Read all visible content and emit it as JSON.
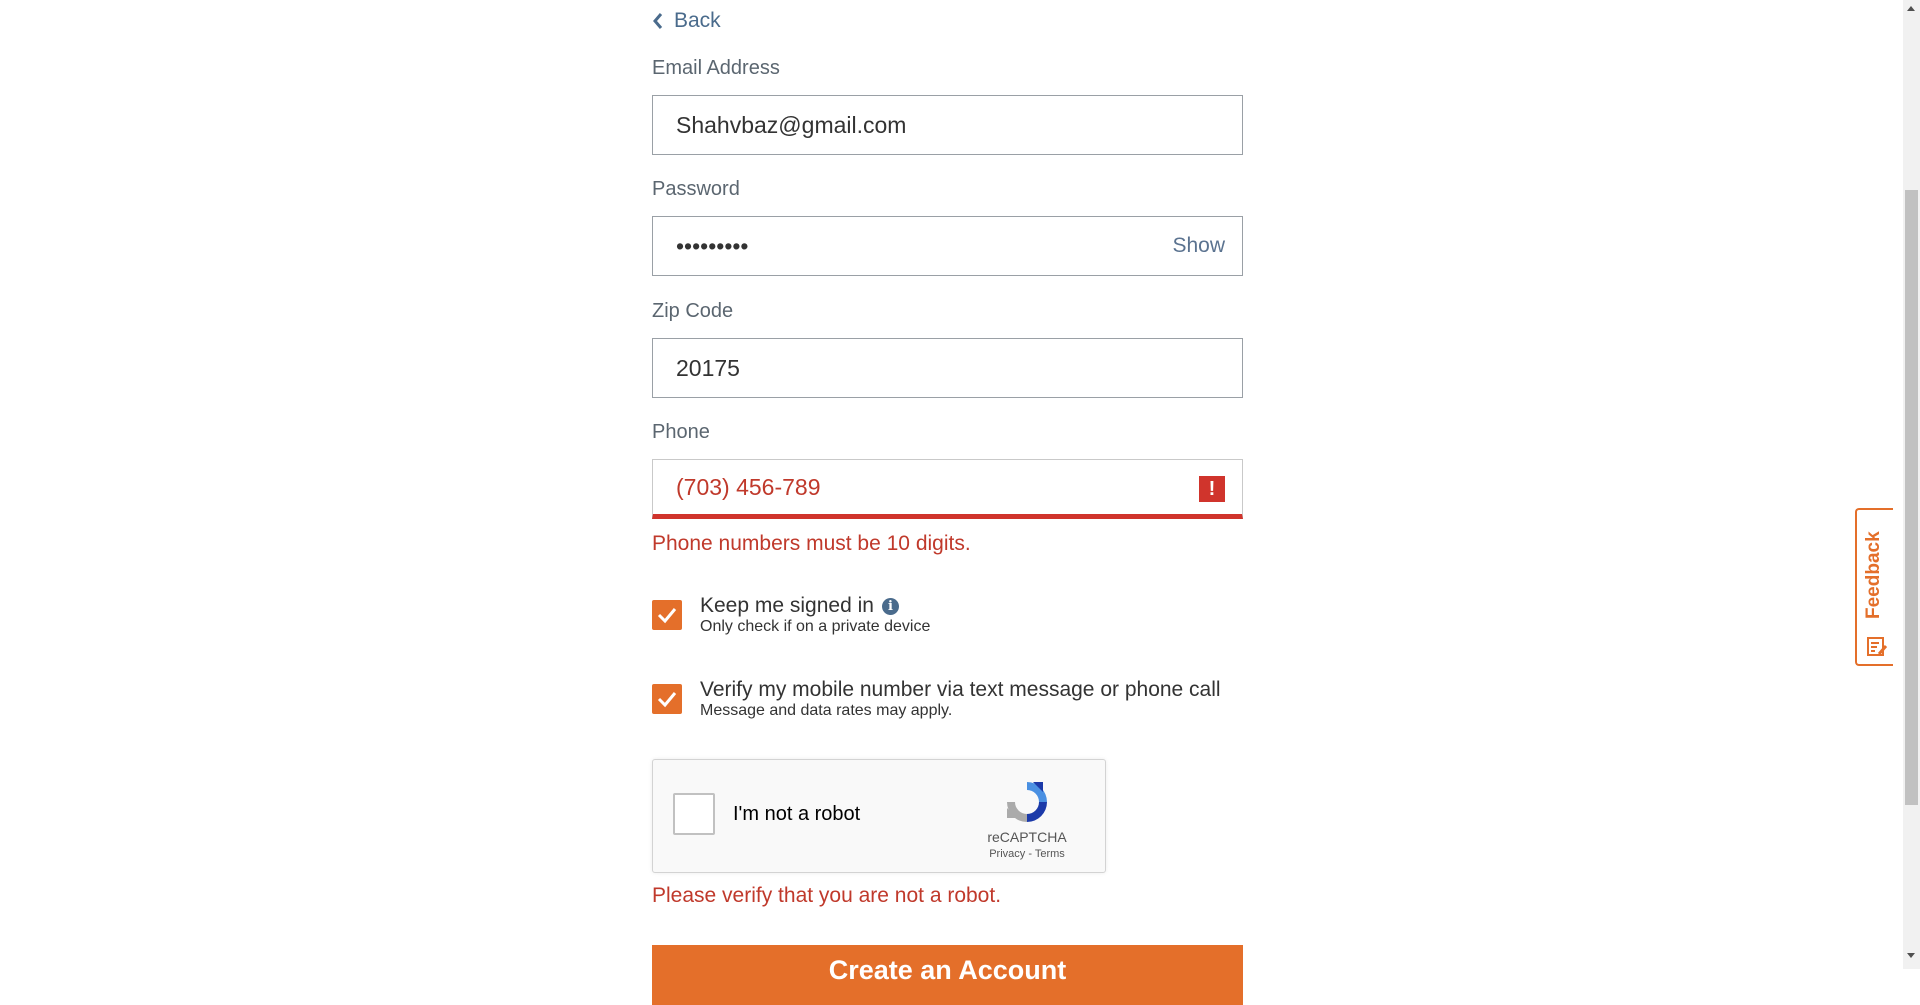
{
  "nav": {
    "back_label": "Back"
  },
  "email": {
    "label": "Email Address",
    "value": "Shahvbaz@gmail.com"
  },
  "password": {
    "label": "Password",
    "value": "•••••••••",
    "toggle_label": "Show"
  },
  "zip": {
    "label": "Zip Code",
    "value": "20175"
  },
  "phone": {
    "label": "Phone",
    "value": "(703) 456-789",
    "error_icon": "!",
    "error_message": "Phone numbers must be 10 digits."
  },
  "options": {
    "keep_signed_in": {
      "title": "Keep me signed in",
      "subtitle": "Only check if on a private device",
      "checked": true,
      "info_icon": "i"
    },
    "verify_mobile": {
      "title": "Verify my mobile number via text message or phone call",
      "subtitle": "Message and data rates may apply.",
      "checked": true
    }
  },
  "captcha": {
    "label": "I'm not a robot",
    "brand": "reCAPTCHA",
    "privacy": "Privacy",
    "separator": " - ",
    "terms": "Terms",
    "error_message": "Please verify that you are not a robot."
  },
  "submit": {
    "label": "Create an Account"
  },
  "feedback": {
    "label": "Feedback"
  },
  "colors": {
    "accent": "#e46f2a",
    "error": "#d0342c",
    "link": "#4a6b8c"
  }
}
